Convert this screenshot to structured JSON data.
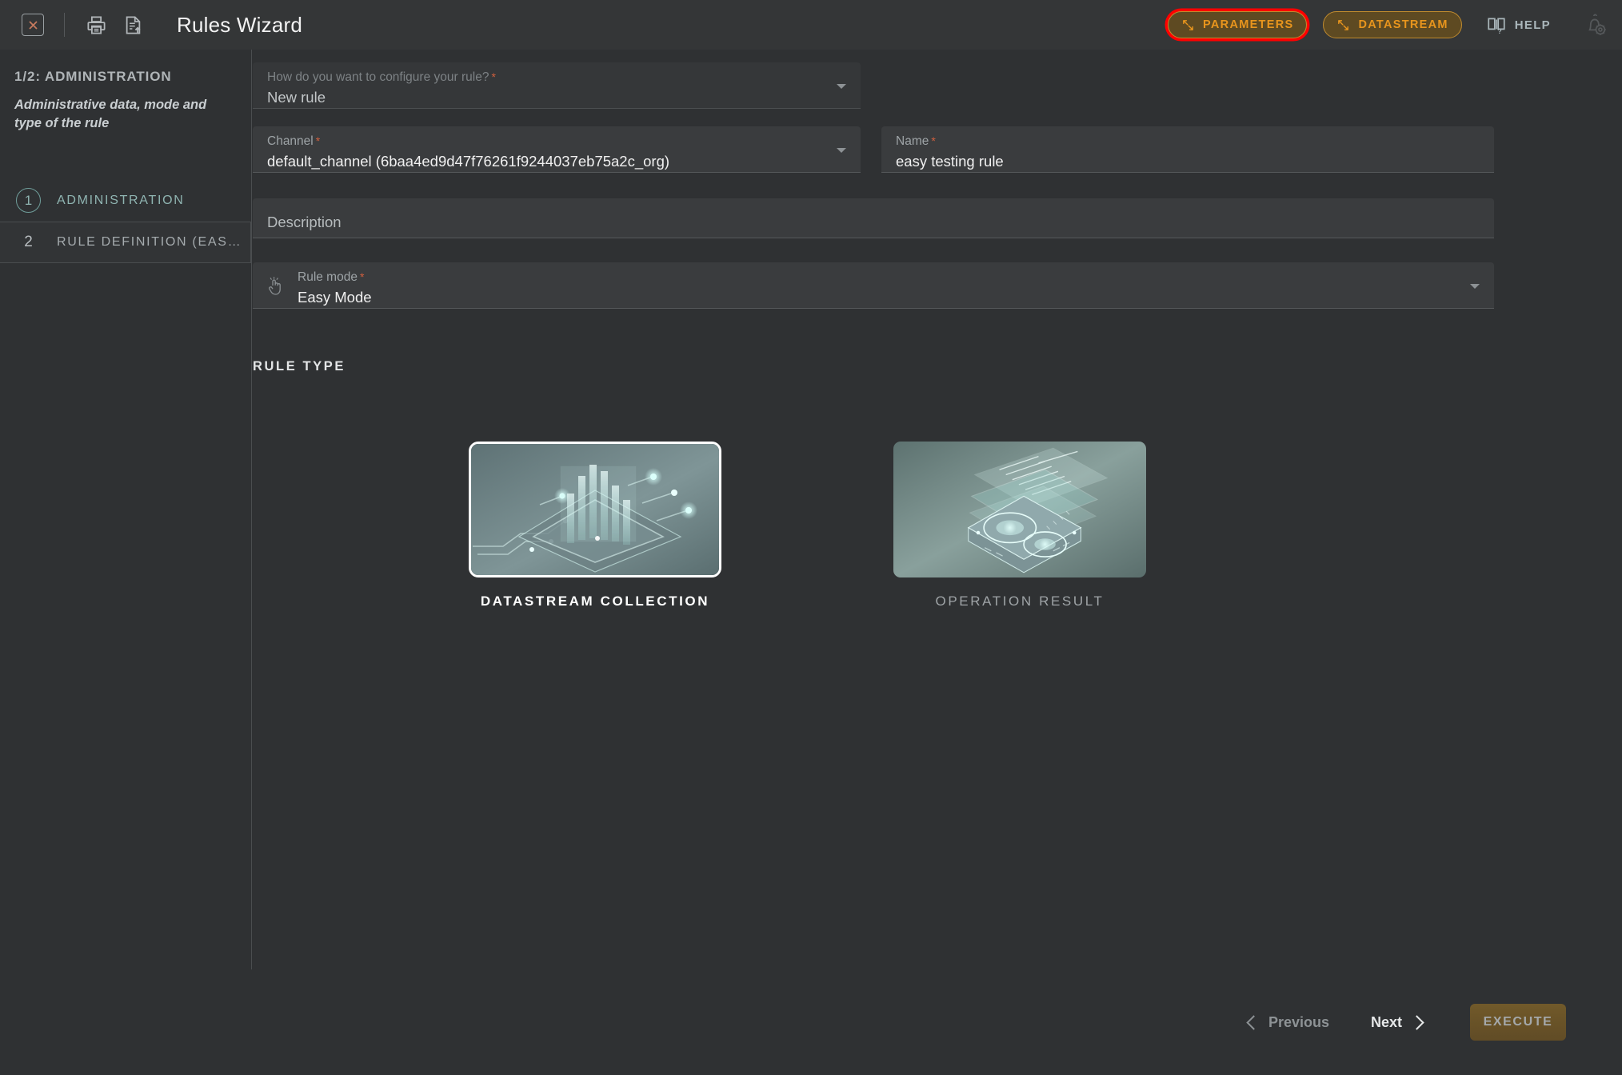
{
  "header": {
    "title": "Rules Wizard",
    "close_icon": "close-x-icon",
    "print_icon": "printer-icon",
    "export_icon": "document-upload-icon",
    "parameters_label": "PARAMETERS",
    "datastream_label": "DATASTREAM",
    "help_label": "HELP",
    "notification_icon": "bell-gear-icon",
    "parameters_icon": "resize-arrows-icon",
    "datastream_icon": "resize-arrows-icon",
    "help_icon": "book-question-icon"
  },
  "sidebar": {
    "step_indicator": "1/2: ADMINISTRATION",
    "step_description": "Administrative data, mode and type of the rule",
    "steps": [
      {
        "num": "1",
        "label": "ADMINISTRATION",
        "state": "active"
      },
      {
        "num": "2",
        "label": "RULE DEFINITION (EAS…",
        "state": "inactive"
      }
    ]
  },
  "form": {
    "configure": {
      "label": "How do you want to configure your rule?",
      "required": "*",
      "value": "New rule"
    },
    "channel": {
      "label": "Channel",
      "required": "*",
      "value": "default_channel (6baa4ed9d47f76261f9244037eb75a2c_org)"
    },
    "name": {
      "label": "Name",
      "required": "*",
      "value": "easy testing rule"
    },
    "description": {
      "placeholder": "Description",
      "value": ""
    },
    "rule_mode": {
      "label": "Rule mode",
      "required": "*",
      "value": "Easy Mode",
      "icon": "click-hand-icon"
    }
  },
  "rule_type": {
    "section_title": "RULE TYPE",
    "options": [
      {
        "label": "DATASTREAM COLLECTION",
        "selected": true
      },
      {
        "label": "OPERATION RESULT",
        "selected": false
      }
    ]
  },
  "footer": {
    "previous_label": "Previous",
    "next_label": "Next",
    "execute_label": "EXECUTE"
  },
  "colors": {
    "page_bg": "#2f3133",
    "header_bg": "#343637",
    "accent_gold": "#e8951d",
    "accent_teal": "#8fb4b1",
    "highlight_red": "#ff0000",
    "required_red": "#d2603e",
    "execute_gold": "#7d6129"
  }
}
